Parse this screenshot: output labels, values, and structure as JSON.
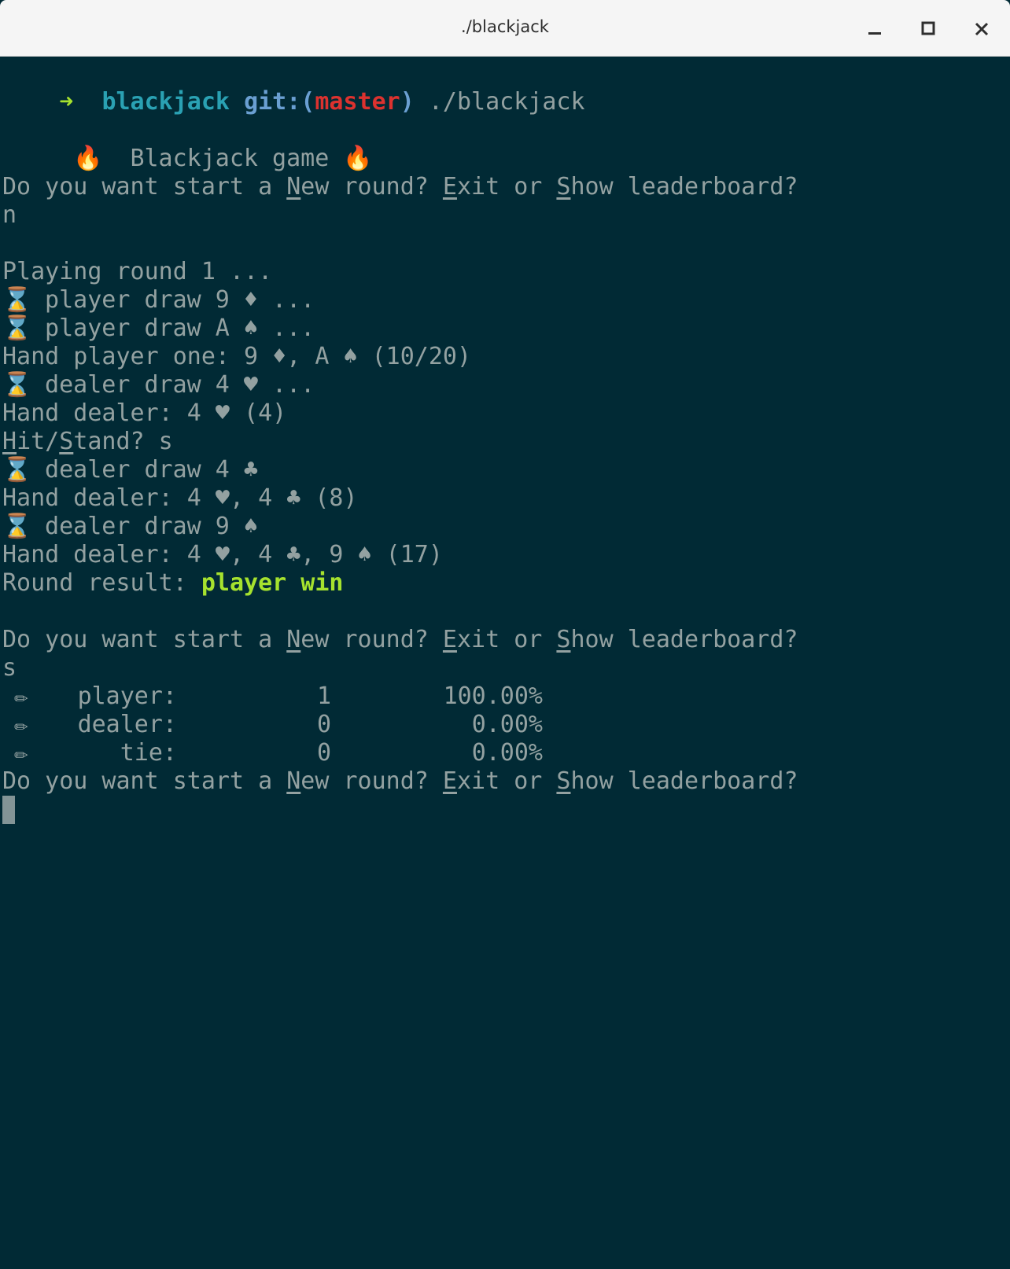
{
  "window": {
    "title": "./blackjack",
    "minimize_icon": "minimize-icon",
    "maximize_icon": "maximize-icon",
    "close_icon": "close-icon"
  },
  "prompt": {
    "arrow": "➜",
    "dir": "blackjack",
    "git_prefix": "git:(",
    "branch": "master",
    "git_suffix": ")",
    "command": " ./blackjack"
  },
  "header": {
    "fire": "🔥",
    "title": "Blackjack game"
  },
  "menu": {
    "part1": "Do you want start a ",
    "new_key": "N",
    "part2": "ew round? ",
    "exit_key": "E",
    "part3": "xit or ",
    "show_key": "S",
    "part4": "how leaderboard?"
  },
  "input1": "n",
  "hourglass": "⌛",
  "round": {
    "playing": "Playing round 1 ...",
    "draw1": " player draw 9 ♦ ...",
    "draw2": " player draw A ♠ ...",
    "hand_player": "Hand player one: 9 ♦, A ♠ (10/20)",
    "draw3": " dealer draw 4 ♥ ...",
    "hand_dealer1": "Hand dealer: 4 ♥ (4)",
    "hit_key": "H",
    "hit_rest": "it/",
    "stand_key": "S",
    "stand_rest": "tand? s",
    "draw4": " dealer draw 4 ♣",
    "hand_dealer2": "Hand dealer: 4 ♥, 4 ♣ (8)",
    "draw5": " dealer draw 9 ♠",
    "hand_dealer3": "Hand dealer: 4 ♥, 4 ♣, 9 ♠ (17)",
    "result_label": "Round result: ",
    "result_value": "player win"
  },
  "input2": "s",
  "leaderboard": {
    "icon": "✏",
    "rows": [
      {
        "name": "player:",
        "count": "1",
        "pct": "100.00%"
      },
      {
        "name": "dealer:",
        "count": "0",
        "pct": "0.00%"
      },
      {
        "name": "tie:",
        "count": "0",
        "pct": "0.00%"
      }
    ]
  },
  "colors": {
    "background": "#012a35",
    "text": "#93a1a1",
    "dir": "#2aa1b3",
    "git": "#6a9fd2",
    "branch": "#dc322f",
    "win": "#a6e22e"
  }
}
